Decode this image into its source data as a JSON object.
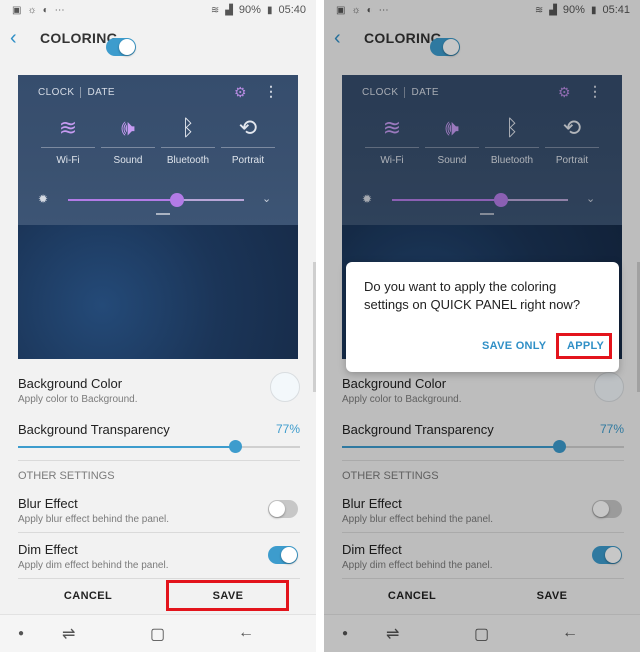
{
  "left_screen": {
    "status": {
      "battery": "90%",
      "time": "05:40"
    },
    "title": "COLORING",
    "toggle_on": true,
    "preview": {
      "clock": "CLOCK",
      "date": "DATE",
      "tiles": [
        {
          "label": "Wi-Fi",
          "icon": "wifi-icon",
          "glyph": "≋",
          "active": true
        },
        {
          "label": "Sound",
          "icon": "sound-icon",
          "glyph": "🕪",
          "active": true
        },
        {
          "label": "Bluetooth",
          "icon": "bluetooth-icon",
          "glyph": "ᛒ",
          "active": false
        },
        {
          "label": "Portrait",
          "icon": "rotate-icon",
          "glyph": "⟲",
          "active": false
        }
      ],
      "brightness": 0.62
    },
    "background_color": {
      "title": "Background Color",
      "subtitle": "Apply color to Background."
    },
    "transparency": {
      "title": "Background Transparency",
      "value": "77%",
      "fraction": 0.77
    },
    "other_settings": "OTHER SETTINGS",
    "blur": {
      "title": "Blur Effect",
      "subtitle": "Apply blur effect behind the panel.",
      "on": false
    },
    "dim": {
      "title": "Dim Effect",
      "subtitle": "Apply dim effect behind the panel.",
      "on": true
    },
    "cancel": "CANCEL",
    "save": "SAVE"
  },
  "right_screen": {
    "status": {
      "battery": "90%",
      "time": "05:41"
    },
    "title": "COLORING",
    "dialog": {
      "message": "Do you want to apply the coloring settings on QUICK PANEL right now?",
      "save_only": "SAVE ONLY",
      "apply": "APPLY"
    },
    "cancel": "CANCEL",
    "save": "SAVE"
  },
  "colors": {
    "accent": "#3d9ccd",
    "purple": "#b27be6",
    "highlight": "#e3141c"
  }
}
